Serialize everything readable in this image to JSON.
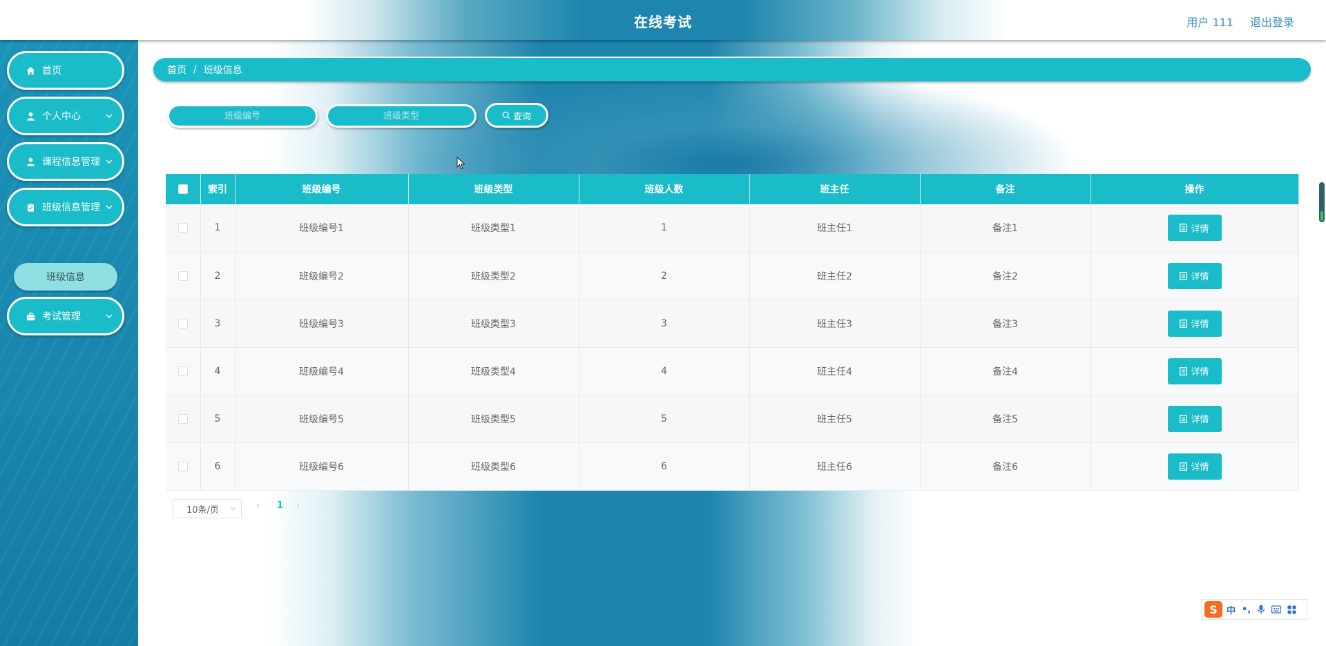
{
  "header": {
    "title": "在线考试",
    "user_label": "用户 111",
    "logout_label": "退出登录"
  },
  "sidebar": {
    "items": [
      {
        "label": "首页",
        "icon": "home-icon",
        "has_chevron": false
      },
      {
        "label": "个人中心",
        "icon": "person-icon",
        "has_chevron": true
      },
      {
        "label": "课程信息管理",
        "icon": "person-icon",
        "has_chevron": true
      },
      {
        "label": "班级信息管理",
        "icon": "clipboard-icon",
        "has_chevron": true
      },
      {
        "label": "考试管理",
        "icon": "briefcase-icon",
        "has_chevron": true
      }
    ],
    "submenu": {
      "label": "班级信息"
    }
  },
  "breadcrumb": {
    "home": "首页",
    "separator": "/",
    "current": "班级信息"
  },
  "search": {
    "class_no_placeholder": "班级编号",
    "class_type_placeholder": "班级类型",
    "query_label": "查询"
  },
  "table": {
    "headers": [
      "索引",
      "班级编号",
      "班级类型",
      "班级人数",
      "班主任",
      "备注",
      "操作"
    ],
    "rows": [
      {
        "index": "1",
        "class_no": "班级编号1",
        "class_type": "班级类型1",
        "count": "1",
        "teacher": "班主任1",
        "note": "备注1"
      },
      {
        "index": "2",
        "class_no": "班级编号2",
        "class_type": "班级类型2",
        "count": "2",
        "teacher": "班主任2",
        "note": "备注2"
      },
      {
        "index": "3",
        "class_no": "班级编号3",
        "class_type": "班级类型3",
        "count": "3",
        "teacher": "班主任3",
        "note": "备注3"
      },
      {
        "index": "4",
        "class_no": "班级编号4",
        "class_type": "班级类型4",
        "count": "4",
        "teacher": "班主任4",
        "note": "备注4"
      },
      {
        "index": "5",
        "class_no": "班级编号5",
        "class_type": "班级类型5",
        "count": "5",
        "teacher": "班主任5",
        "note": "备注5"
      },
      {
        "index": "6",
        "class_no": "班级编号6",
        "class_type": "班级类型6",
        "count": "6",
        "teacher": "班主任6",
        "note": "备注6"
      }
    ],
    "detail_label": "详情"
  },
  "pagination": {
    "page_size": "10条/页",
    "prev": "‹",
    "current_page": "1",
    "next": "›"
  },
  "ime": {
    "logo": "S",
    "mode": "中",
    "punct": "•,"
  },
  "colors": {
    "accent": "#19bcc8",
    "sidebar_bg": "#1a86ae",
    "header_text": "#3a91b5"
  }
}
